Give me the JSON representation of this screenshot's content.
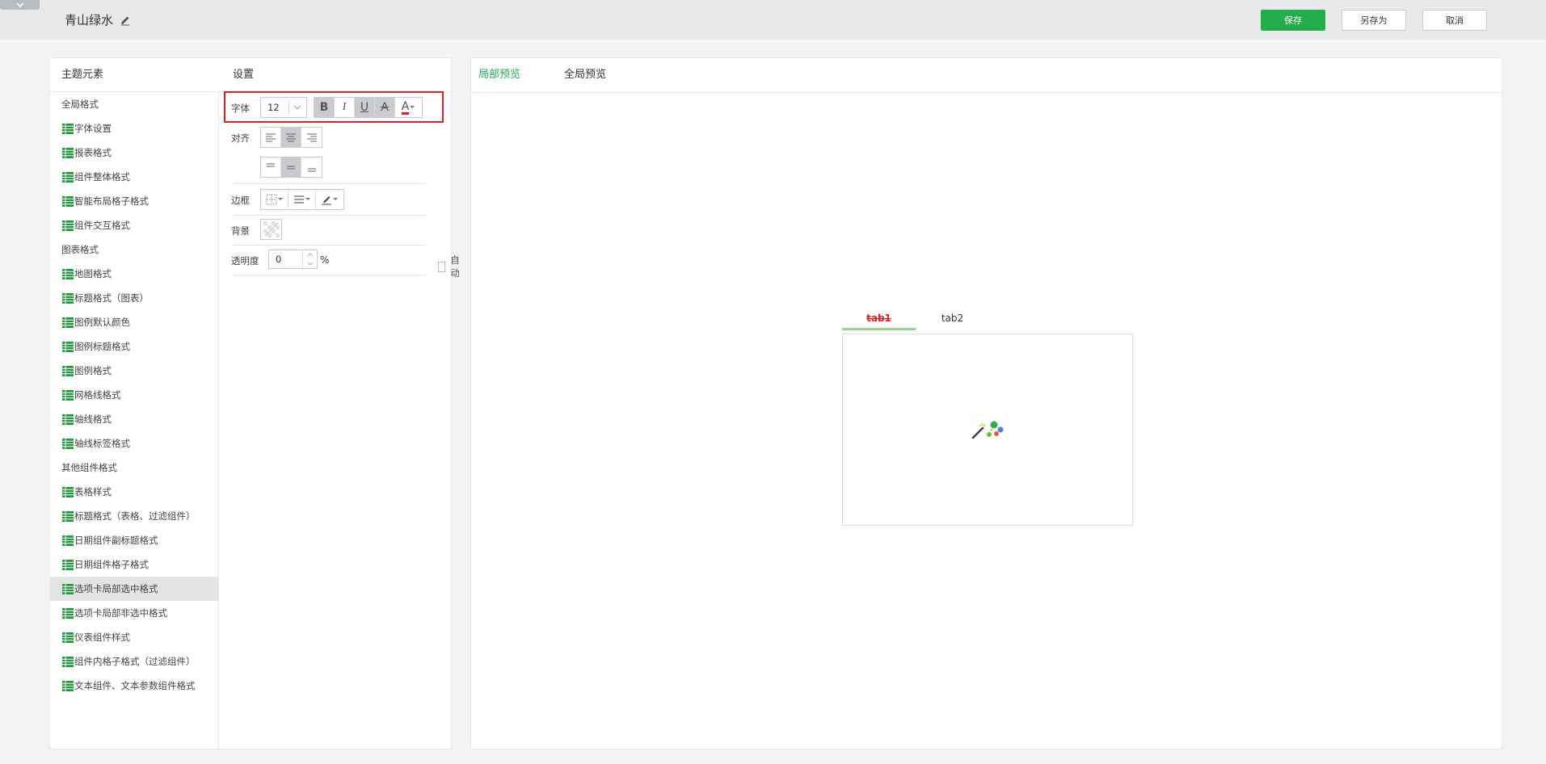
{
  "header": {
    "title": "青山绿水",
    "save_label": "保存",
    "save_as_label": "另存为",
    "cancel_label": "取消"
  },
  "left": {
    "elements_title": "主题元素",
    "settings_title": "设置",
    "items": [
      {
        "label": "全局格式",
        "group": true
      },
      {
        "label": "字体设置",
        "group": false
      },
      {
        "label": "报表格式",
        "group": false
      },
      {
        "label": "组件整体格式",
        "group": false
      },
      {
        "label": "智能布局格子格式",
        "group": false
      },
      {
        "label": "组件交互格式",
        "group": false
      },
      {
        "label": "图表格式",
        "group": true
      },
      {
        "label": "地图格式",
        "group": false
      },
      {
        "label": "标题格式（图表）",
        "group": false
      },
      {
        "label": "图例默认颜色",
        "group": false
      },
      {
        "label": "图例标题格式",
        "group": false
      },
      {
        "label": "图例格式",
        "group": false
      },
      {
        "label": "网格线格式",
        "group": false
      },
      {
        "label": "轴线格式",
        "group": false
      },
      {
        "label": "轴线标签格式",
        "group": false
      },
      {
        "label": "其他组件格式",
        "group": true
      },
      {
        "label": "表格样式",
        "group": false
      },
      {
        "label": "标题格式（表格、过滤组件）",
        "group": false
      },
      {
        "label": "日期组件副标题格式",
        "group": false
      },
      {
        "label": "日期组件格子格式",
        "group": false
      },
      {
        "label": "选项卡局部选中格式",
        "group": false,
        "selected": true
      },
      {
        "label": "选项卡局部非选中格式",
        "group": false
      },
      {
        "label": "仪表组件样式",
        "group": false
      },
      {
        "label": "组件内格子格式（过滤组件）",
        "group": false
      },
      {
        "label": "文本组件、文本参数组件格式",
        "group": false
      }
    ]
  },
  "settings": {
    "font_label": "字体",
    "font_size": "12",
    "bold": "B",
    "italic": "I",
    "underline": "U",
    "strike": "A",
    "font_color": "A",
    "align_label": "对齐",
    "border_label": "边框",
    "background_label": "背景",
    "opacity_label": "透明度",
    "opacity_value": "0",
    "percent": "%",
    "auto_label": "自动"
  },
  "preview": {
    "tab_local": "局部预览",
    "tab_global": "全局预览",
    "tabs": [
      "tab1",
      "tab2"
    ]
  },
  "colors": {
    "accent": "#23ad4b",
    "highlight": "#e02020"
  }
}
